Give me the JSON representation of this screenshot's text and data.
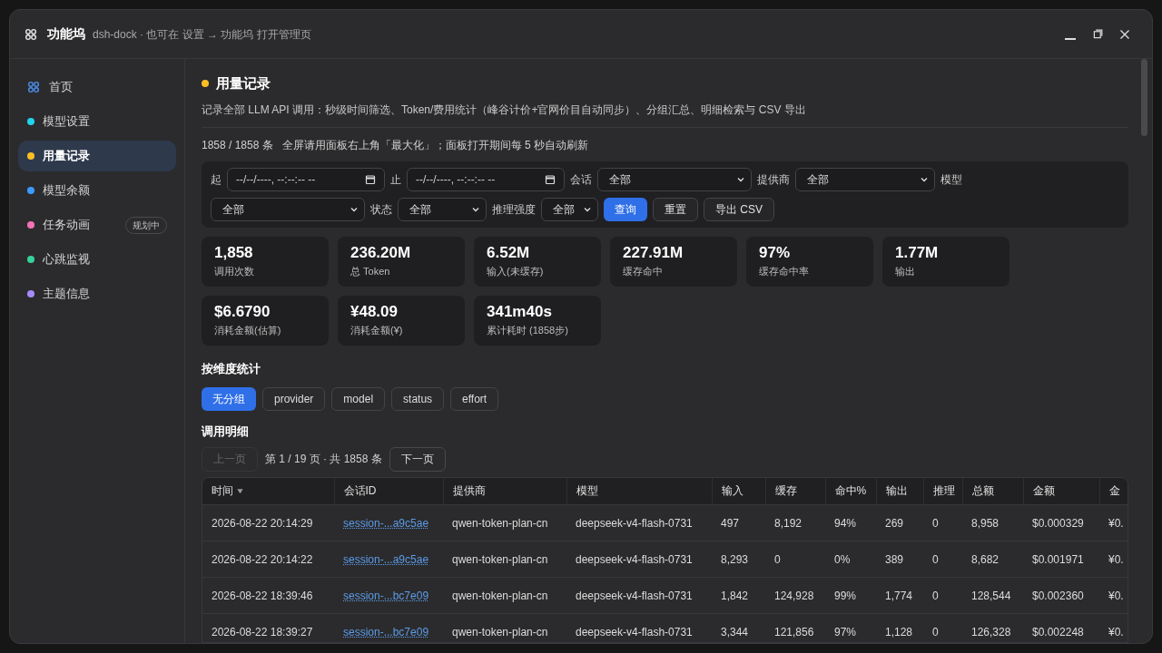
{
  "window": {
    "title": "功能坞",
    "subtitle": "dsh-dock · 也可在 设置 → 功能坞 打开管理页"
  },
  "sidebar": {
    "items": [
      {
        "kind": "home",
        "label": "首页",
        "selected": false
      },
      {
        "kind": "dot",
        "label": "模型设置",
        "color": "#22d3ee",
        "selected": false
      },
      {
        "kind": "dot",
        "label": "用量记录",
        "color": "#fbbf24",
        "selected": true
      },
      {
        "kind": "dot",
        "label": "模型余额",
        "color": "#3b9cff",
        "selected": false
      },
      {
        "kind": "dot",
        "label": "任务动画",
        "color": "#f472b6",
        "selected": false,
        "badge": "规划中"
      },
      {
        "kind": "dot",
        "label": "心跳监视",
        "color": "#34d399",
        "selected": false
      },
      {
        "kind": "dot",
        "label": "主题信息",
        "color": "#a78bfa",
        "selected": false
      }
    ]
  },
  "page": {
    "title": "用量记录",
    "color": "#fbbf24",
    "description": "记录全部 LLM API 调用：秒级时间筛选、Token/费用统计（峰谷计价+官网价目自动同步）、分组汇总、明细检索与 CSV 导出",
    "count": "1858 / 1858 条",
    "hint": "全屏请用面板右上角「最大化」；面板打开期间每 5 秒自动刷新"
  },
  "filters": [
    [
      {
        "kind": "label",
        "text": "起"
      },
      {
        "kind": "date",
        "value": "--/--/----, --:--:-- --"
      },
      {
        "kind": "label",
        "text": "止"
      },
      {
        "kind": "date",
        "value": "--/--/----, --:--:-- --"
      },
      {
        "kind": "label",
        "text": "会话"
      },
      {
        "kind": "select",
        "value": "全部"
      },
      {
        "kind": "label",
        "text": "提供商"
      },
      {
        "kind": "select",
        "value": "全部"
      },
      {
        "kind": "label",
        "text": "模型"
      }
    ],
    [
      {
        "kind": "select",
        "value": "全部"
      },
      {
        "kind": "label",
        "text": "状态"
      },
      {
        "kind": "select",
        "value": "全部"
      },
      {
        "kind": "label",
        "text": "推理强度"
      },
      {
        "kind": "select",
        "value": "全部"
      },
      {
        "kind": "button",
        "text": "查询",
        "primary": true
      },
      {
        "kind": "button",
        "text": "重置",
        "primary": false
      },
      {
        "kind": "button",
        "text": "导出 CSV",
        "primary": false
      }
    ]
  ],
  "stats": [
    {
      "value": "1,858",
      "label": "调用次数"
    },
    {
      "value": "236.20M",
      "label": "总 Token"
    },
    {
      "value": "6.52M",
      "label": "输入(未缓存)"
    },
    {
      "value": "227.91M",
      "label": "缓存命中"
    },
    {
      "value": "97%",
      "label": "缓存命中率"
    },
    {
      "value": "1.77M",
      "label": "输出"
    },
    {
      "value": "$6.6790",
      "label": "消耗金额(估算)"
    },
    {
      "value": "¥48.09",
      "label": "消耗金额(¥)"
    },
    {
      "value": "341m40s",
      "label": "累计耗时 (1858步)"
    }
  ],
  "grouping": {
    "title": "按维度统计",
    "options": [
      {
        "label": "无分组",
        "selected": true
      },
      {
        "label": "provider",
        "selected": false
      },
      {
        "label": "model",
        "selected": false
      },
      {
        "label": "status",
        "selected": false
      },
      {
        "label": "effort",
        "selected": false
      }
    ]
  },
  "detail": {
    "title": "调用明细",
    "prev": {
      "label": "上一页",
      "disabled": true
    },
    "info": "第 1 / 19 页 · 共 1858 条",
    "next": {
      "label": "下一页",
      "disabled": false
    }
  },
  "table": {
    "columns": [
      {
        "label": "时间",
        "sorted": true
      },
      {
        "label": "会话ID",
        "sorted": false
      },
      {
        "label": "提供商",
        "sorted": false
      },
      {
        "label": "模型",
        "sorted": false
      },
      {
        "label": "输入",
        "sorted": false
      },
      {
        "label": "缓存",
        "sorted": false
      },
      {
        "label": "命中%",
        "sorted": false
      },
      {
        "label": "输出",
        "sorted": false
      },
      {
        "label": "推理",
        "sorted": false
      },
      {
        "label": "总额",
        "sorted": false
      },
      {
        "label": "金额",
        "sorted": false
      },
      {
        "label": "金",
        "sorted": false
      }
    ],
    "rows": [
      [
        "2026-08-22 20:14:29",
        "session-...a9c5ae",
        "qwen-token-plan-cn",
        "deepseek-v4-flash-0731",
        "497",
        "8,192",
        "94%",
        "269",
        "0",
        "8,958",
        "$0.000329",
        "¥0."
      ],
      [
        "2026-08-22 20:14:22",
        "session-...a9c5ae",
        "qwen-token-plan-cn",
        "deepseek-v4-flash-0731",
        "8,293",
        "0",
        "0%",
        "389",
        "0",
        "8,682",
        "$0.001971",
        "¥0."
      ],
      [
        "2026-08-22 18:39:46",
        "session-...bc7e09",
        "qwen-token-plan-cn",
        "deepseek-v4-flash-0731",
        "1,842",
        "124,928",
        "99%",
        "1,774",
        "0",
        "128,544",
        "$0.002360",
        "¥0."
      ],
      [
        "2026-08-22 18:39:27",
        "session-...bc7e09",
        "qwen-token-plan-cn",
        "deepseek-v4-flash-0731",
        "3,344",
        "121,856",
        "97%",
        "1,128",
        "0",
        "126,328",
        "$0.002248",
        "¥0."
      ]
    ]
  }
}
